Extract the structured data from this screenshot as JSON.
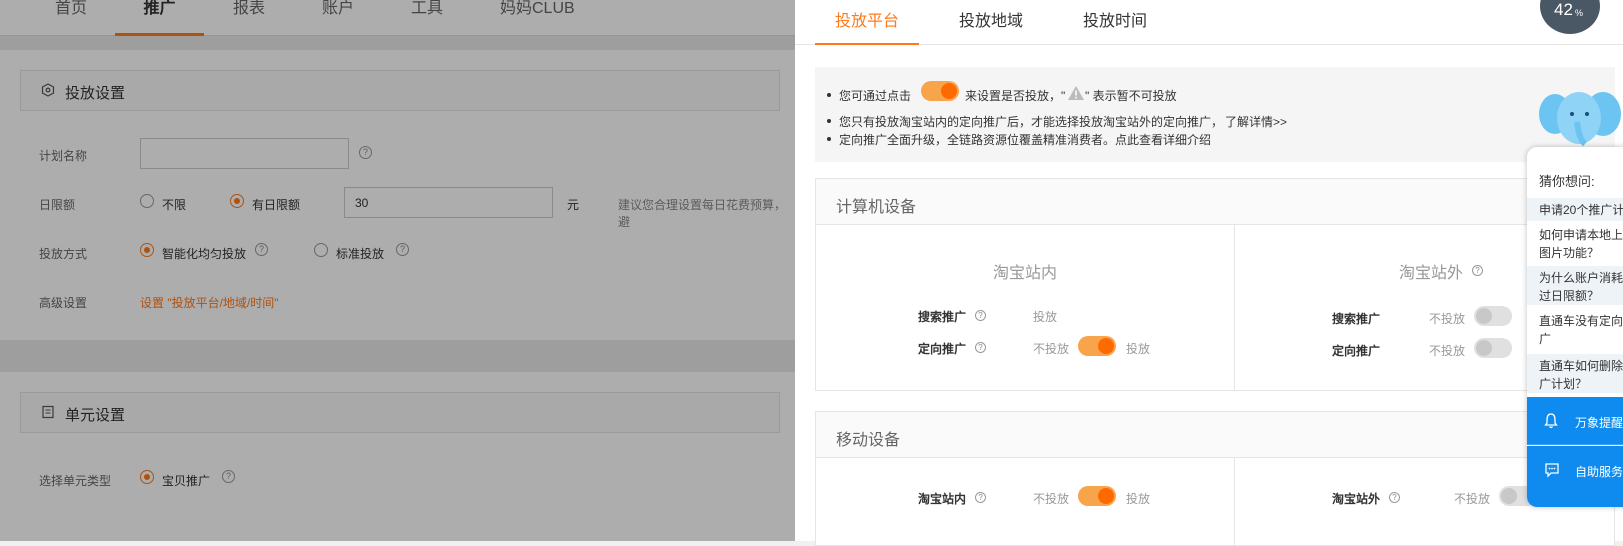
{
  "topnav": {
    "tabs": [
      {
        "label": "首页"
      },
      {
        "label": "推广"
      },
      {
        "label": "报表"
      },
      {
        "label": "账户"
      },
      {
        "label": "工具"
      },
      {
        "label": "妈妈CLUB"
      }
    ],
    "active_index": 1
  },
  "delivery_settings": {
    "title": "投放设置",
    "plan_name_label": "计划名称",
    "plan_name_value": "",
    "daily_limit_label": "日限额",
    "no_limit_label": "不限",
    "has_limit_label": "有日限额",
    "limit_value": "30",
    "unit": "元",
    "limit_hint": "建议您合理设置每日花费预算，避",
    "method_label": "投放方式",
    "smart_label": "智能化均匀投放",
    "standard_label": "标准投放",
    "advanced_label": "高级设置",
    "advanced_link": "设置 \"投放平台/地域/时间\""
  },
  "unit_settings": {
    "title": "单元设置",
    "type_label": "选择单元类型",
    "type_option": "宝贝推广"
  },
  "panel": {
    "tabs": [
      {
        "label": "投放平台"
      },
      {
        "label": "投放地域"
      },
      {
        "label": "投放时间"
      }
    ],
    "active_tab": 0,
    "tips": {
      "line1_a": "您可通过点击",
      "line1_b": "来设置是否投放，\"",
      "line1_c": "\" 表示暂不可投放",
      "line2": "您只有投放淘宝站内的定向推广后，才能选择投放淘宝站外的定向推广，",
      "line2_link": "了解详情>>",
      "line3": "定向推广全面升级，全链路资源位覆盖精准消费者。点此查看详细介绍"
    },
    "computer": {
      "title": "计算机设备",
      "inside_title": "淘宝站内",
      "outside_title": "淘宝站外",
      "search_label": "搜索推广",
      "targeted_label": "定向推广",
      "search_in_value": "投放",
      "off_label": "不投放",
      "on_label": "投放"
    },
    "mobile": {
      "title": "移动设备",
      "inside_label": "淘宝站内",
      "outside_label": "淘宝站外",
      "off_label": "不投放",
      "on_label": "投放"
    }
  },
  "widget": {
    "percent": "42",
    "percent_sign": "%"
  },
  "chat": {
    "header": "猜你想问:",
    "questions": [
      "申请20个推广计",
      "如何申请本地上\n图片功能？",
      "为什么账户消耗\n过日限额？",
      "直通车没有定向\n广",
      "直通车如何删除\n广计划？"
    ],
    "reminder": "万象提醒",
    "service": "自助服务"
  },
  "colors": {
    "accent": "#ff7a1a",
    "chat_blue": "#0f8bf0"
  }
}
